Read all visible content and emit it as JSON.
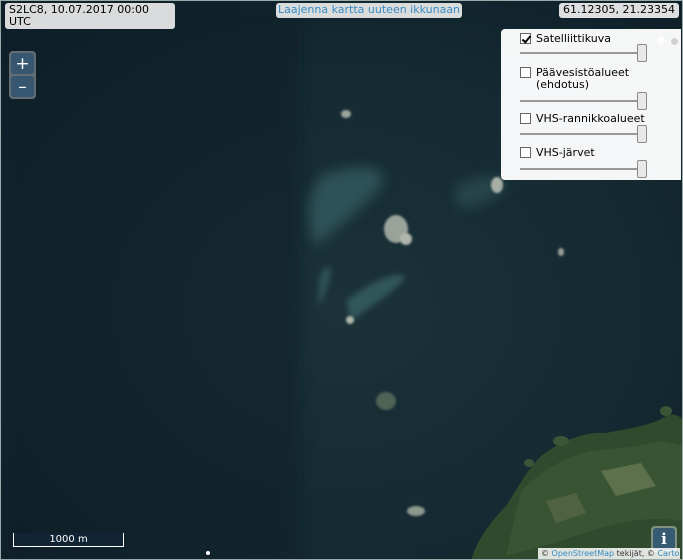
{
  "map": {
    "info_line1": "S2LC8, 10.07.2017 00:00",
    "info_line2": "UTC",
    "expand_link": "Laajenna kartta uuteen ikkunaan",
    "coordinates": "61.12305, 21.23354",
    "zoom_in": "+",
    "zoom_out": "–",
    "scale_label": "1000 m",
    "info_button": "i",
    "attribution": {
      "prefix": "©",
      "osm_link": "OpenStreetMap",
      "contrib": "tekijät, ©",
      "carto_link": "Carto"
    },
    "layers": [
      {
        "label": "Satelliittikuva",
        "checked": true
      },
      {
        "label": "Päävesistöalueet (ehdotus)",
        "checked": false
      },
      {
        "label": "VHS-rannikkoalueet",
        "checked": false
      },
      {
        "label": "VHS-järvet",
        "checked": false
      }
    ],
    "colors": {
      "sea": "#142730",
      "land": "#2f4a2c",
      "link": "#3a8ac0"
    }
  }
}
